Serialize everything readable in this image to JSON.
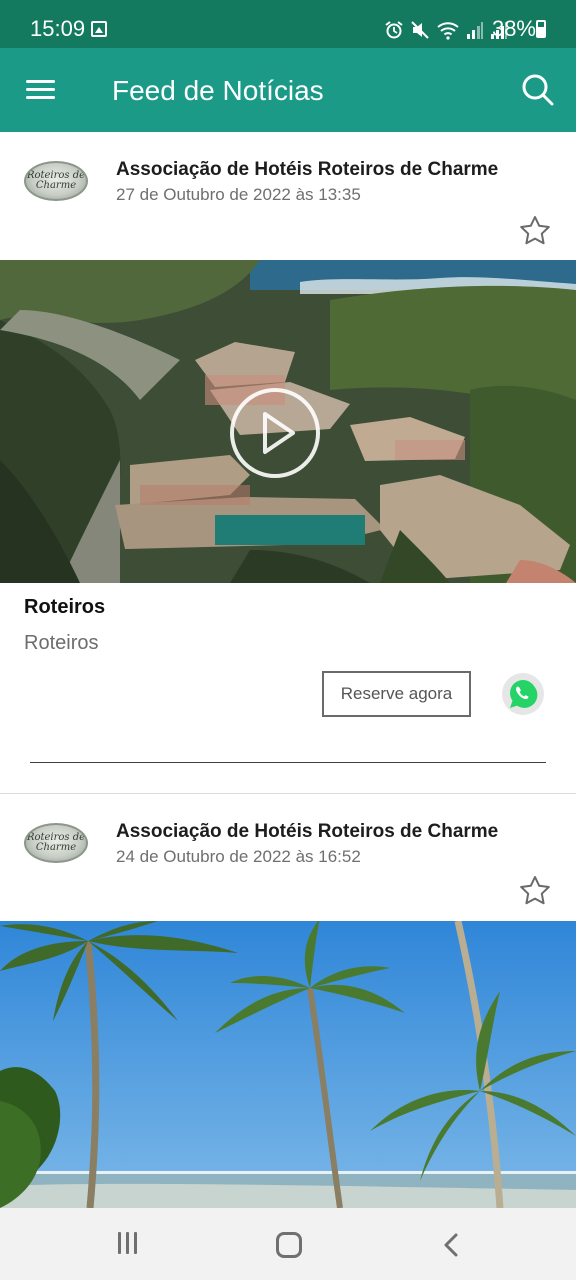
{
  "status_bar": {
    "time": "15:09",
    "battery_text": "38%",
    "icons": [
      "gallery-icon",
      "alarm-icon",
      "mute-icon",
      "wifi-icon",
      "signal-icon",
      "signal-icon",
      "battery-icon"
    ]
  },
  "app_bar": {
    "title": "Feed de Notícias",
    "menu_icon": "menu-icon",
    "search_icon": "search-icon",
    "color": "#1a9a87"
  },
  "posts": [
    {
      "logo_text": "Roteiros de Charme",
      "author": "Associação de Hotéis Roteiros de Charme",
      "date": "27 de Outubro de 2022 às 13:35",
      "favorite_icon": "star-outline-icon",
      "media_type": "video",
      "title": "Roteiros",
      "subtitle": "Roteiros",
      "reserve_label": "Reserve agora",
      "share_icon": "whatsapp-icon"
    },
    {
      "logo_text": "Roteiros de Charme",
      "author": "Associação de Hotéis Roteiros de Charme",
      "date": "24 de Outubro de 2022 às 16:52",
      "favorite_icon": "star-outline-icon",
      "media_type": "image"
    }
  ],
  "nav_bar": {
    "recent_icon": "recent-apps-icon",
    "home_icon": "home-icon",
    "back_icon": "back-icon"
  },
  "colors": {
    "status_bar": "#137a5f",
    "app_bar": "#1a9a87",
    "whatsapp": "#25d366"
  }
}
